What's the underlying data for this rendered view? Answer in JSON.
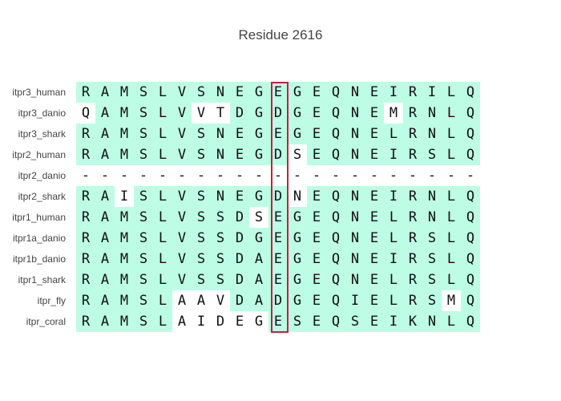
{
  "title": "Residue 2616",
  "colors": {
    "match_bg": "#bdfde6",
    "highlight": "#c0223f"
  },
  "highlight_column": 10,
  "rows": [
    {
      "label": "itpr3_human",
      "seq": "RAMSLVSNEGEGEQNEIRILQ",
      "match": "111111111111111111111"
    },
    {
      "label": "itpr3_danio",
      "seq": "QAMSLVVTDGDGEQNEMRNLQ",
      "match": "011111001111111101111"
    },
    {
      "label": "itpr3_shark",
      "seq": "RAMSLVSNEGEGEQNELRNLQ",
      "match": "111111111111111111111"
    },
    {
      "label": "itpr2_human",
      "seq": "RAMSLVSNEGDSEQNEIRSLQ",
      "match": "111111111110111111111"
    },
    {
      "label": "itpr2_danio",
      "seq": "---------------------",
      "match": "000000000000000000000"
    },
    {
      "label": "itpr2_shark",
      "seq": "RAISLVSNEGDNEQNEIRNLQ",
      "match": "110111111110111111111"
    },
    {
      "label": "itpr1_human",
      "seq": "RAMSLVSSDSEGEQNELRNLQ",
      "match": "111111111011111111111"
    },
    {
      "label": "itpr1a_danio",
      "seq": "RAMSLVSSDGEGEQNELRSLQ",
      "match": "111111111111111111111"
    },
    {
      "label": "itpr1b_danio",
      "seq": "RAMSLVSSDAEGEQNEIRSLQ",
      "match": "111111111111111111111"
    },
    {
      "label": "itpr1_shark",
      "seq": "RAMSLVSSDAEGEQNELRSLQ",
      "match": "111111111111111111111"
    },
    {
      "label": "itpr_fly",
      "seq": "RAMSLAAVDADGEQIELRSMQ",
      "match": "111110001111111111101"
    },
    {
      "label": "itpr_coral",
      "seq": "RAMSLAIDEGESEQSEIKNLQ",
      "match": "111110000011111111111"
    }
  ]
}
